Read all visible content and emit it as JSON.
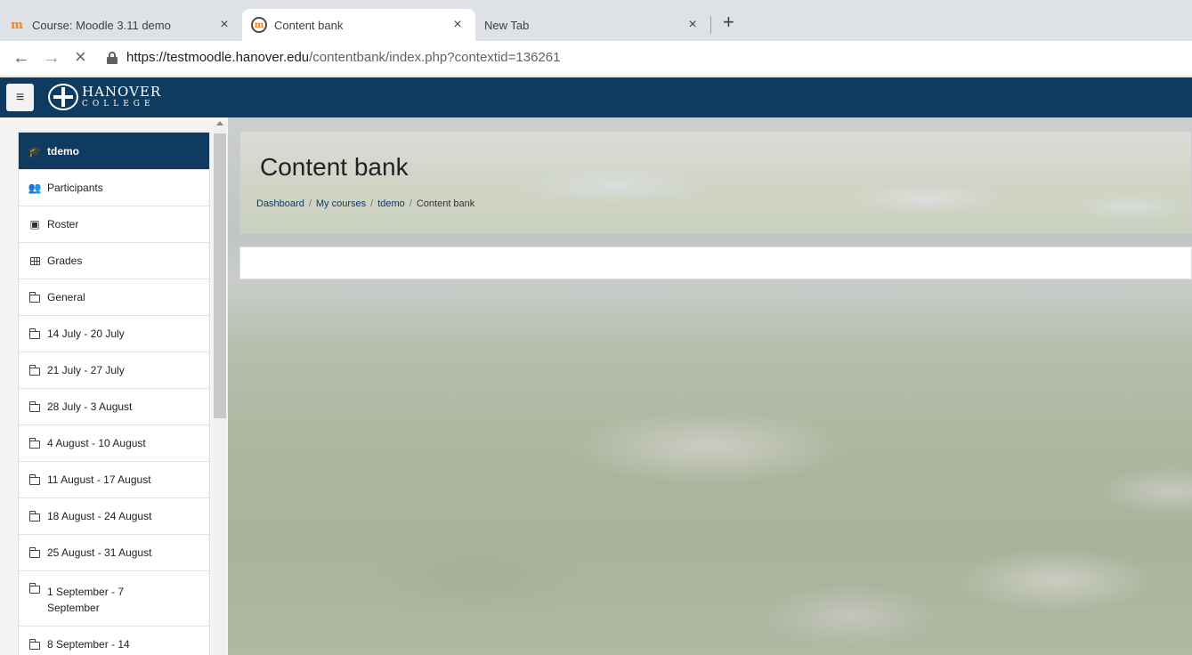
{
  "browser": {
    "tabs": [
      {
        "title": "Course: Moodle 3.11 demo",
        "icon": "moodle-icon"
      },
      {
        "title": "Content bank",
        "icon": "moodle-circle-icon",
        "active": true
      },
      {
        "title": "New Tab",
        "icon": ""
      }
    ],
    "close_glyph": "×",
    "newtab_glyph": "+",
    "url_host": "https://testmoodle.hanover.edu",
    "url_path": "/contentbank/index.php?contextid=136261"
  },
  "navbar": {
    "logo_main": "HANOVER",
    "logo_sub": "COLLEGE",
    "colors": {
      "navbar": "#0f3b61"
    }
  },
  "drawer": {
    "items": [
      {
        "label": "tdemo",
        "icon": "graduation-cap-icon",
        "active": true
      },
      {
        "label": "Participants",
        "icon": "users-icon"
      },
      {
        "label": "Roster",
        "icon": "roster-icon"
      },
      {
        "label": "Grades",
        "icon": "table-icon"
      },
      {
        "label": "General",
        "icon": "folder-icon"
      },
      {
        "label": "14 July - 20 July",
        "icon": "folder-icon"
      },
      {
        "label": "21 July - 27 July",
        "icon": "folder-icon"
      },
      {
        "label": "28 July - 3 August",
        "icon": "folder-icon"
      },
      {
        "label": "4 August - 10 August",
        "icon": "folder-icon"
      },
      {
        "label": "11 August - 17 August",
        "icon": "folder-icon"
      },
      {
        "label": "18 August - 24 August",
        "icon": "folder-icon"
      },
      {
        "label": "25 August - 31 August",
        "icon": "folder-icon"
      },
      {
        "label": "1 September - 7 September",
        "icon": "folder-icon"
      },
      {
        "label": "8 September - 14",
        "icon": "folder-icon"
      }
    ]
  },
  "page": {
    "title": "Content bank",
    "breadcrumb": [
      "Dashboard",
      "My courses",
      "tdemo",
      "Content bank"
    ],
    "breadcrumb_sep": "/"
  }
}
